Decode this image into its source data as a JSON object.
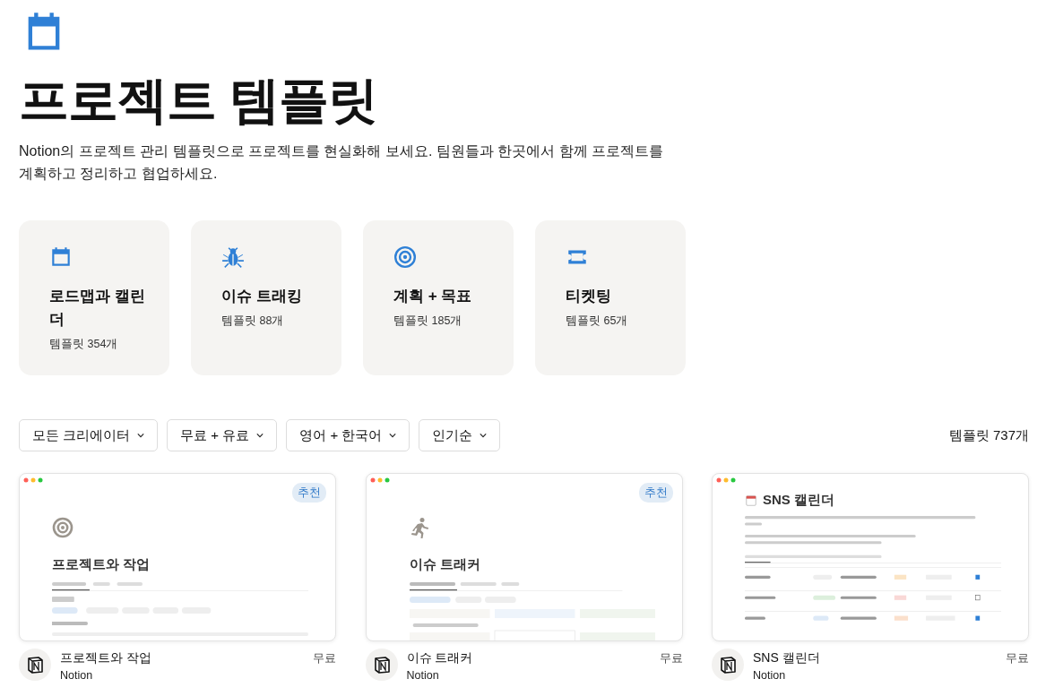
{
  "header": {
    "title": "프로젝트 템플릿",
    "description": "Notion의 프로젝트 관리 템플릿으로 프로젝트를 현실화해 보세요. 팀원들과 한곳에서 함께 프로젝트를 계획하고 정리하고 협업하세요."
  },
  "categories": [
    {
      "kind": "calendar",
      "title": "로드맵과 캘린더",
      "count": "템플릿 354개"
    },
    {
      "kind": "bug",
      "title": "이슈 트래킹",
      "count": "템플릿 88개"
    },
    {
      "kind": "target",
      "title": "계획 + 목표",
      "count": "템플릿 185개"
    },
    {
      "kind": "ticket",
      "title": "티켓팅",
      "count": "템플릿 65개"
    }
  ],
  "filters": [
    {
      "label": "모든 크리에이터"
    },
    {
      "label": "무료 + 유료"
    },
    {
      "label": "영어 + 한국어"
    },
    {
      "label": "인기순"
    }
  ],
  "total": "템플릿 737개",
  "templates": [
    {
      "badge": "추천",
      "preview": {
        "kind": "tasks",
        "title": "프로젝트와 작업"
      },
      "name": "프로젝트와 작업",
      "creator": "Notion",
      "price": "무료"
    },
    {
      "badge": "추천",
      "preview": {
        "kind": "tracker",
        "title": "이슈 트래커"
      },
      "name": "이슈 트래커",
      "creator": "Notion",
      "price": "무료"
    },
    {
      "preview": {
        "kind": "calendar",
        "title": "SNS 캘린더"
      },
      "name": "SNS 캘린더",
      "creator": "Notion",
      "price": "무료"
    }
  ]
}
